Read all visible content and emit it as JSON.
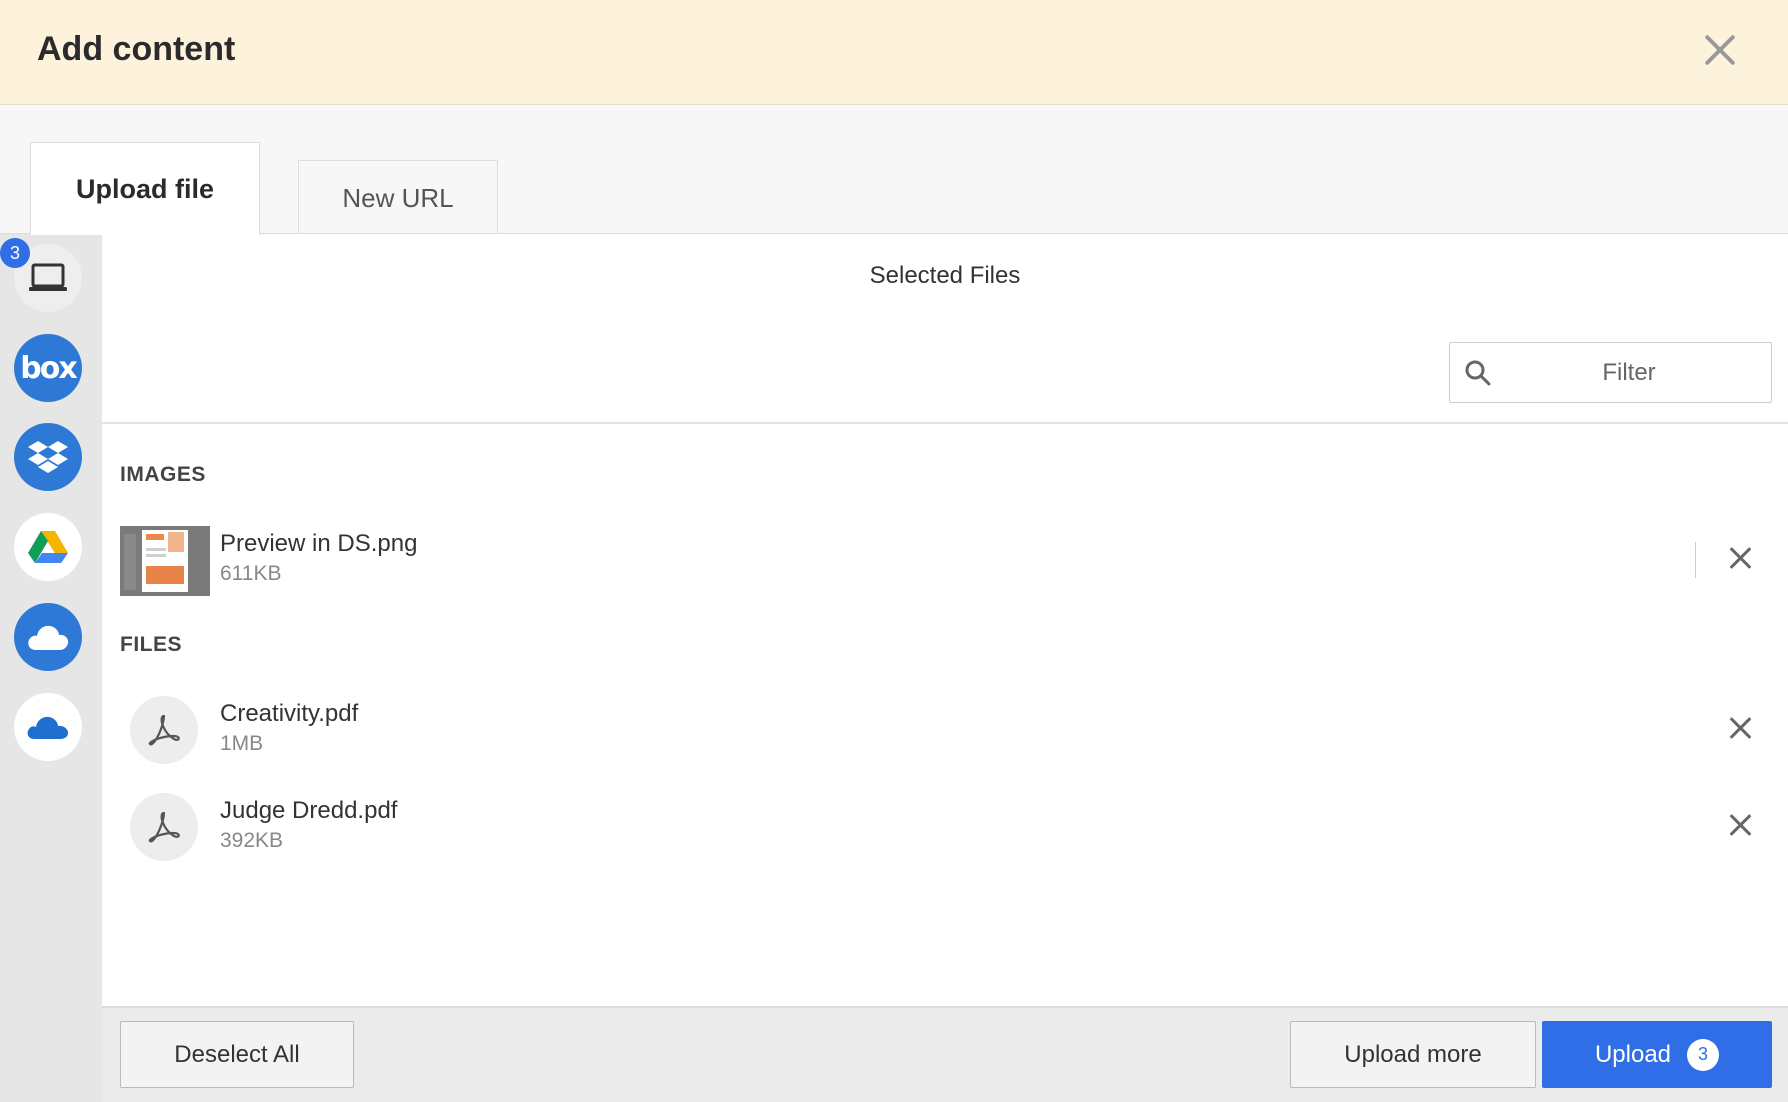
{
  "dialog": {
    "title": "Add content",
    "close_icon": "close-icon"
  },
  "tabs": [
    {
      "label": "Upload file",
      "active": true
    },
    {
      "label": "New URL",
      "active": false
    }
  ],
  "sources": {
    "badge_count": "3",
    "box_label": "box",
    "items": [
      "computer-icon",
      "box-icon",
      "dropbox-icon",
      "google-drive-icon",
      "cloud-icon",
      "onedrive-icon"
    ]
  },
  "panel": {
    "heading": "Selected Files",
    "filter_placeholder": "Filter"
  },
  "sections": {
    "images_label": "IMAGES",
    "files_label": "FILES"
  },
  "images": [
    {
      "name": "Preview in DS.png",
      "size": "611KB"
    }
  ],
  "files": [
    {
      "name": "Creativity.pdf",
      "size": "1MB"
    },
    {
      "name": "Judge Dredd.pdf",
      "size": "392KB"
    }
  ],
  "footer": {
    "deselect_label": "Deselect All",
    "upload_more_label": "Upload more",
    "upload_label": "Upload",
    "upload_count": "3"
  },
  "colors": {
    "accent": "#2f6ee6",
    "header_bg": "#fdf3dc",
    "source_blue": "#2f79d6"
  }
}
